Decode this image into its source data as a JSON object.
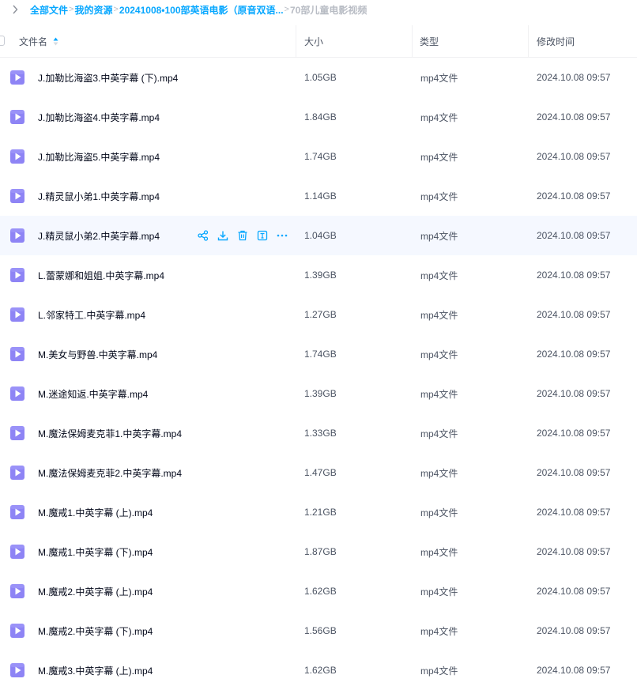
{
  "breadcrumb": {
    "items": [
      "全部文件",
      "我的资源",
      "20241008•100部英语电影（原音双语...",
      "70部儿童电影视频"
    ],
    "separator": ">"
  },
  "table": {
    "headers": {
      "name": "文件名",
      "size": "大小",
      "type": "类型",
      "time": "修改时间"
    },
    "rows": [
      {
        "name": "J.加勒比海盗3.中英字幕 (下).mp4",
        "size": "1.05GB",
        "type": "mp4文件",
        "time": "2024.10.08 09:57"
      },
      {
        "name": "J.加勒比海盗4.中英字幕.mp4",
        "size": "1.84GB",
        "type": "mp4文件",
        "time": "2024.10.08 09:57"
      },
      {
        "name": "J.加勒比海盗5.中英字幕.mp4",
        "size": "1.74GB",
        "type": "mp4文件",
        "time": "2024.10.08 09:57"
      },
      {
        "name": "J.精灵鼠小弟1.中英字幕.mp4",
        "size": "1.14GB",
        "type": "mp4文件",
        "time": "2024.10.08 09:57"
      },
      {
        "name": "J.精灵鼠小弟2.中英字幕.mp4",
        "size": "1.04GB",
        "type": "mp4文件",
        "time": "2024.10.08 09:57"
      },
      {
        "name": "L.蕾蒙娜和姐姐.中英字幕.mp4",
        "size": "1.39GB",
        "type": "mp4文件",
        "time": "2024.10.08 09:57"
      },
      {
        "name": "L.邻家特工.中英字幕.mp4",
        "size": "1.27GB",
        "type": "mp4文件",
        "time": "2024.10.08 09:57"
      },
      {
        "name": "M.美女与野兽.中英字幕.mp4",
        "size": "1.74GB",
        "type": "mp4文件",
        "time": "2024.10.08 09:57"
      },
      {
        "name": "M.迷途知返.中英字幕.mp4",
        "size": "1.39GB",
        "type": "mp4文件",
        "time": "2024.10.08 09:57"
      },
      {
        "name": "M.魔法保姆麦克菲1.中英字幕.mp4",
        "size": "1.33GB",
        "type": "mp4文件",
        "time": "2024.10.08 09:57"
      },
      {
        "name": "M.魔法保姆麦克菲2.中英字幕.mp4",
        "size": "1.47GB",
        "type": "mp4文件",
        "time": "2024.10.08 09:57"
      },
      {
        "name": "M.魔戒1.中英字幕 (上).mp4",
        "size": "1.21GB",
        "type": "mp4文件",
        "time": "2024.10.08 09:57"
      },
      {
        "name": "M.魔戒1.中英字幕 (下).mp4",
        "size": "1.87GB",
        "type": "mp4文件",
        "time": "2024.10.08 09:57"
      },
      {
        "name": "M.魔戒2.中英字幕 (上).mp4",
        "size": "1.62GB",
        "type": "mp4文件",
        "time": "2024.10.08 09:57"
      },
      {
        "name": "M.魔戒2.中英字幕 (下).mp4",
        "size": "1.56GB",
        "type": "mp4文件",
        "time": "2024.10.08 09:57"
      },
      {
        "name": "M.魔戒3.中英字幕 (上).mp4",
        "size": "1.62GB",
        "type": "mp4文件",
        "time": "2024.10.08 09:57"
      }
    ],
    "hovered_row_index": 4,
    "hover_actions": [
      "share-icon",
      "download-icon",
      "delete-icon",
      "text-icon",
      "more-icon"
    ]
  },
  "colors": {
    "accent": "#06a7ff",
    "video_icon": "#8e84f5",
    "video_icon_light": "#b3abff",
    "hover_row": "#f5f8ff",
    "breadcrumb_current": "#b8bcc4"
  }
}
